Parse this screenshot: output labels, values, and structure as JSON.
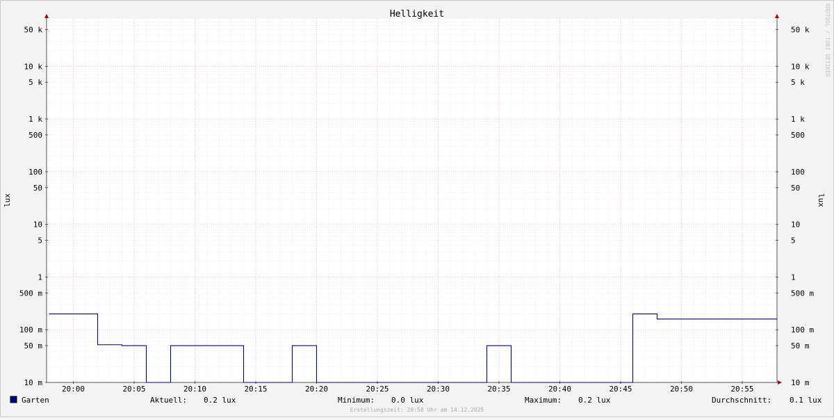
{
  "chart_data": {
    "type": "line",
    "title": "Helligkeit",
    "ylabel": "lux",
    "y_scale": "log",
    "ylim": [
      0.01,
      80000
    ],
    "y_ticks": [
      {
        "value": 50000,
        "label": "50 k"
      },
      {
        "value": 10000,
        "label": "10 k"
      },
      {
        "value": 5000,
        "label": "5 k"
      },
      {
        "value": 1000,
        "label": "1 k"
      },
      {
        "value": 500,
        "label": "500"
      },
      {
        "value": 100,
        "label": "100"
      },
      {
        "value": 50,
        "label": "50"
      },
      {
        "value": 10,
        "label": "10"
      },
      {
        "value": 5,
        "label": "5"
      },
      {
        "value": 1,
        "label": "1"
      },
      {
        "value": 0.5,
        "label": "500 m"
      },
      {
        "value": 0.1,
        "label": "100 m"
      },
      {
        "value": 0.05,
        "label": "50 m"
      },
      {
        "value": 0.01,
        "label": "10 m"
      }
    ],
    "x_ticks": [
      "20:00",
      "20:05",
      "20:10",
      "20:15",
      "20:20",
      "20:25",
      "20:30",
      "20:35",
      "20:40",
      "20:45",
      "20:50",
      "20:55"
    ],
    "series": [
      {
        "name": "Garten",
        "color": "#000099",
        "points": [
          [
            "19:58",
            0.2
          ],
          [
            "20:02",
            0.2
          ],
          [
            "20:02",
            0.052
          ],
          [
            "20:04",
            0.052
          ],
          [
            "20:04",
            0.05
          ],
          [
            "20:06",
            0.05
          ],
          [
            "20:06",
            0.01
          ],
          [
            "20:08",
            0.01
          ],
          [
            "20:08",
            0.05
          ],
          [
            "20:14",
            0.05
          ],
          [
            "20:14",
            0.01
          ],
          [
            "20:18",
            0.01
          ],
          [
            "20:18",
            0.05
          ],
          [
            "20:20",
            0.05
          ],
          [
            "20:20",
            0.01
          ],
          [
            "20:34",
            0.01
          ],
          [
            "20:34",
            0.05
          ],
          [
            "20:36",
            0.05
          ],
          [
            "20:36",
            0.01
          ],
          [
            "20:46",
            0.01
          ],
          [
            "20:46",
            0.2
          ],
          [
            "20:48",
            0.2
          ],
          [
            "20:48",
            0.16
          ],
          [
            "20:58",
            0.16
          ]
        ]
      }
    ],
    "grid": true,
    "legend": {
      "name": "Garten",
      "color": "#000099",
      "aktuell_label": "Aktuell:",
      "aktuell_value": "0.2 lux",
      "minimum_label": "Minimum:",
      "minimum_value": "0.0 lux",
      "maximum_label": "Maximum:",
      "maximum_value": "0.2 lux",
      "durchschnitt_label": "Durchschnitt:",
      "durchschnitt_value": "0.1 lux"
    }
  },
  "credit": "RRDTOOL / TOBI OETIKER",
  "footer": "Erstellungszeit: 20:58 Uhr am 14.12.2025"
}
